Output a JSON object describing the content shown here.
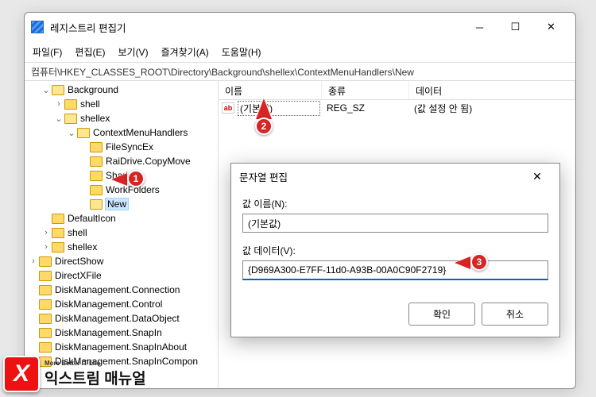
{
  "window": {
    "title": "레지스트리 편집기"
  },
  "menu": {
    "file": "파일(F)",
    "edit": "편집(E)",
    "view": "보기(V)",
    "favorites": "즐겨찾기(A)",
    "help": "도움말(H)"
  },
  "path": "컴퓨터\\HKEY_CLASSES_ROOT\\Directory\\Background\\shellex\\ContextMenuHandlers\\New",
  "tree": {
    "items": [
      {
        "depth": 0,
        "exp": "v",
        "open": true,
        "label": "Background"
      },
      {
        "depth": 1,
        "exp": ">",
        "label": "shell"
      },
      {
        "depth": 1,
        "exp": "v",
        "open": true,
        "label": "shellex"
      },
      {
        "depth": 2,
        "exp": "v",
        "open": true,
        "label": "ContextMenuHandlers"
      },
      {
        "depth": 3,
        "exp": "",
        "label": "FileSyncEx"
      },
      {
        "depth": 3,
        "exp": "",
        "label": "RaiDrive.CopyMove"
      },
      {
        "depth": 3,
        "exp": "",
        "label": "Sharing"
      },
      {
        "depth": 3,
        "exp": "",
        "label": "WorkFolders"
      },
      {
        "depth": 3,
        "exp": "",
        "open": true,
        "label": "New",
        "selected": true
      },
      {
        "depth": 0,
        "exp": "",
        "label": "DefaultIcon"
      },
      {
        "depth": 0,
        "exp": ">",
        "label": "shell"
      },
      {
        "depth": 0,
        "exp": ">",
        "label": "shellex"
      },
      {
        "depth": -1,
        "exp": ">",
        "label": "DirectShow"
      },
      {
        "depth": -1,
        "exp": "",
        "label": "DirectXFile"
      },
      {
        "depth": -1,
        "exp": "",
        "label": "DiskManagement.Connection"
      },
      {
        "depth": -1,
        "exp": "",
        "label": "DiskManagement.Control"
      },
      {
        "depth": -1,
        "exp": "",
        "label": "DiskManagement.DataObject"
      },
      {
        "depth": -1,
        "exp": "",
        "label": "DiskManagement.SnapIn"
      },
      {
        "depth": -1,
        "exp": "",
        "label": "DiskManagement.SnapInAbout"
      },
      {
        "depth": -1,
        "exp": "",
        "label": "DiskManagement.SnapInCompon"
      }
    ]
  },
  "list": {
    "headers": {
      "name": "이름",
      "type": "종류",
      "data": "데이터"
    },
    "rows": [
      {
        "icon": "ab",
        "name": "(기본값)",
        "type": "REG_SZ",
        "data": "(값 설정 안 됨)",
        "selected": true
      }
    ]
  },
  "dialog": {
    "title": "문자열 편집",
    "name_label": "값 이름(N):",
    "name_value": "(기본값)",
    "data_label": "값 데이터(V):",
    "data_value": "{D969A300-E7FF-11d0-A93B-00A0C90F2719}",
    "ok": "확인",
    "cancel": "취소"
  },
  "markers": {
    "m1": "1",
    "m2": "2",
    "m3": "3"
  },
  "logo": {
    "main": "익스트림 매뉴얼",
    "sub": "More Better IT Life",
    "x": "X"
  }
}
